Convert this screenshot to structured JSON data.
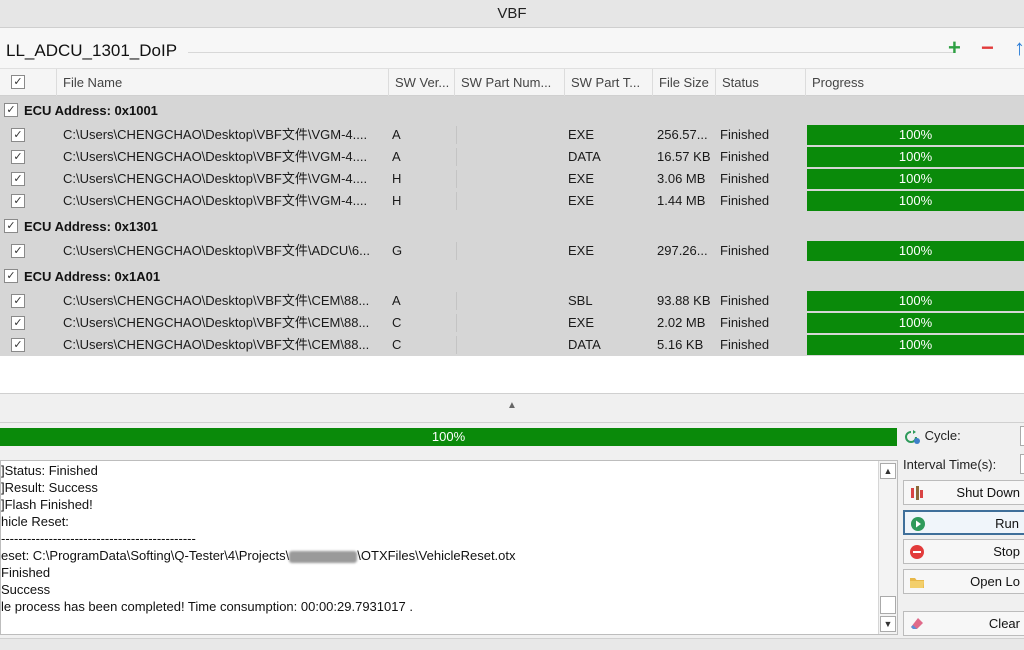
{
  "window": {
    "title": "VBF"
  },
  "project": {
    "title": "LL_ADCU_1301_DoIP"
  },
  "columns": [
    "File Name",
    "SW Ver...",
    "SW Part Num...",
    "SW Part T...",
    "File Size",
    "Status",
    "Progress"
  ],
  "header_check": "✓",
  "groups": [
    {
      "label": "ECU Address: 0x1001",
      "rows": [
        {
          "file": "C:\\Users\\CHENGCHAO\\Desktop\\VBF文件\\VGM-4....",
          "ver": "A",
          "part": "",
          "type": "EXE",
          "size": "256.57...",
          "status": "Finished",
          "progress": "100%"
        },
        {
          "file": "C:\\Users\\CHENGCHAO\\Desktop\\VBF文件\\VGM-4....",
          "ver": "A",
          "part": "",
          "type": "DATA",
          "size": "16.57 KB",
          "status": "Finished",
          "progress": "100%"
        },
        {
          "file": "C:\\Users\\CHENGCHAO\\Desktop\\VBF文件\\VGM-4....",
          "ver": "H",
          "part": "",
          "type": "EXE",
          "size": "3.06 MB",
          "status": "Finished",
          "progress": "100%"
        },
        {
          "file": "C:\\Users\\CHENGCHAO\\Desktop\\VBF文件\\VGM-4....",
          "ver": "H",
          "part": "",
          "type": "EXE",
          "size": "1.44 MB",
          "status": "Finished",
          "progress": "100%"
        }
      ]
    },
    {
      "label": "ECU Address: 0x1301",
      "rows": [
        {
          "file": "C:\\Users\\CHENGCHAO\\Desktop\\VBF文件\\ADCU\\6...",
          "ver": "G",
          "part": "",
          "type": "EXE",
          "size": "297.26...",
          "status": "Finished",
          "progress": "100%"
        }
      ]
    },
    {
      "label": "ECU Address: 0x1A01",
      "rows": [
        {
          "file": "C:\\Users\\CHENGCHAO\\Desktop\\VBF文件\\CEM\\88...",
          "ver": "A",
          "part": "",
          "type": "SBL",
          "size": "93.88 KB",
          "status": "Finished",
          "progress": "100%"
        },
        {
          "file": "C:\\Users\\CHENGCHAO\\Desktop\\VBF文件\\CEM\\88...",
          "ver": "C",
          "part": "",
          "type": "EXE",
          "size": "2.02 MB",
          "status": "Finished",
          "progress": "100%"
        },
        {
          "file": "C:\\Users\\CHENGCHAO\\Desktop\\VBF文件\\CEM\\88...",
          "ver": "C",
          "part": "",
          "type": "DATA",
          "size": "5.16 KB",
          "status": "Finished",
          "progress": "100%"
        }
      ]
    }
  ],
  "overall_progress": {
    "label": "100%",
    "value": 1.0
  },
  "log": {
    "lines": [
      "]Status: Finished",
      "]Result: Success",
      "]Flash Finished!",
      "hicle Reset:",
      "---------------------------------------------",
      "eset: C:\\ProgramData\\Softing\\Q-Tester\\4\\Projects\\",
      "Finished",
      "Success",
      "le process has been completed! Time consumption: 00:00:29.7931017 ."
    ],
    "path_suffix": "\\OTXFiles\\VehicleReset.otx"
  },
  "controls": {
    "cycle_label": "Cycle:",
    "interval_label": "Interval Time(s):",
    "shutdown_label": "Shut Down",
    "run_label": "Run",
    "stop_label": "Stop",
    "open_log_label": "Open Lo",
    "clear_label": "Clear"
  },
  "colors": {
    "progress_green": "#0a8a0a",
    "grid_bg": "#d6d6d6",
    "add": "#2ea043",
    "remove": "#e23b3b"
  }
}
